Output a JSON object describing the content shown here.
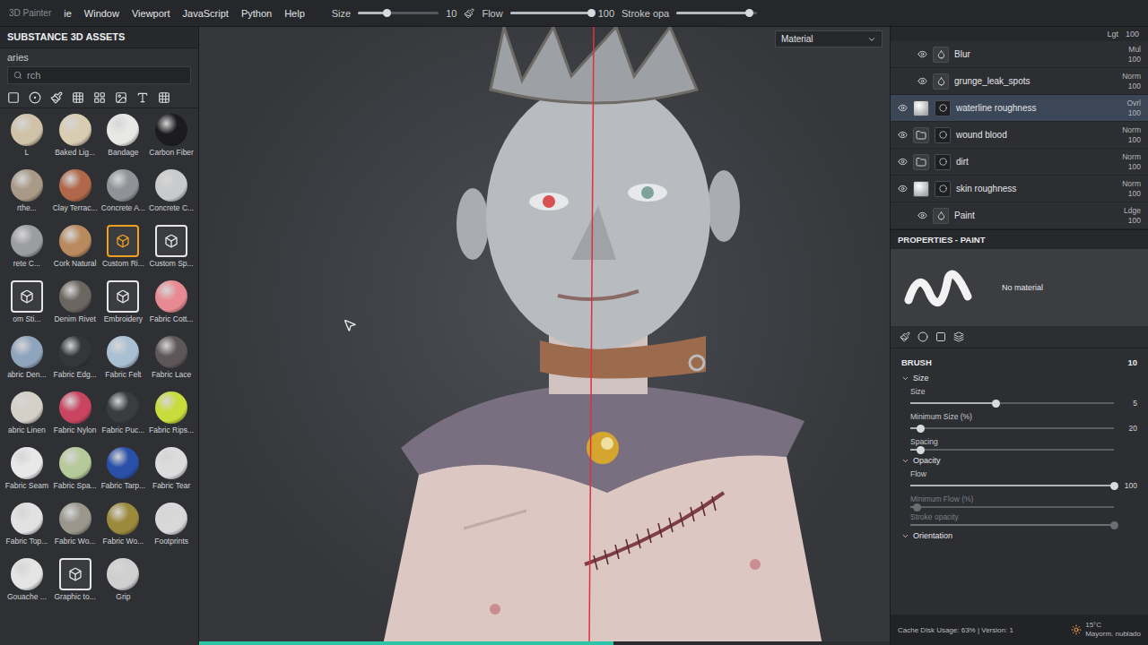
{
  "app": {
    "title": "3D Painter"
  },
  "menu": [
    {
      "label": "ie"
    },
    {
      "label": "Window"
    },
    {
      "label": "Viewport"
    },
    {
      "label": "JavaScript"
    },
    {
      "label": "Python"
    },
    {
      "label": "Help"
    }
  ],
  "toolbar": {
    "size": {
      "label": "Size",
      "value": "10",
      "level": 0.35
    },
    "flow": {
      "label": "Flow",
      "value": "100",
      "level": 1
    },
    "stroke": {
      "label": "Stroke opa",
      "level": 0.9
    }
  },
  "assets": {
    "title": "SUBSTANCE 3D ASSETS",
    "section": "aries",
    "search": "rch",
    "materials": [
      {
        "label": "L",
        "kind": "sphere",
        "color": "#cfc2a6"
      },
      {
        "label": "Baked Lig...",
        "kind": "sphere",
        "color": "#d9ccb0"
      },
      {
        "label": "Bandage",
        "kind": "sphere",
        "color": "#e8e8e6"
      },
      {
        "label": "Carbon Fiber",
        "kind": "sphere",
        "color": "#1c1c1e"
      },
      {
        "label": "rthe...",
        "kind": "sphere",
        "color": "#a89a86"
      },
      {
        "label": "Clay Terrac...",
        "kind": "sphere",
        "color": "#b0674a"
      },
      {
        "label": "Concrete A...",
        "kind": "sphere",
        "color": "#8f9296"
      },
      {
        "label": "Concrete C...",
        "kind": "sphere",
        "color": "#c9cacb"
      },
      {
        "label": "rete C...",
        "kind": "sphere",
        "color": "#9c9d9f"
      },
      {
        "label": "Cork Natural",
        "kind": "sphere",
        "color": "#b98a5e"
      },
      {
        "label": "Custom Ri...",
        "kind": "icon",
        "color": "#f0a020"
      },
      {
        "label": "Custom Sp...",
        "kind": "icon",
        "color": "#e6e6e6"
      },
      {
        "label": "om Sti...",
        "kind": "icon",
        "color": "#e6e6e6"
      },
      {
        "label": "Denim Rivet",
        "kind": "sphere",
        "color": "#6c6660"
      },
      {
        "label": "Embroidery",
        "kind": "icon",
        "color": "#e6e6e6"
      },
      {
        "label": "Fabric Cott...",
        "kind": "sphere",
        "color": "#e88a92"
      },
      {
        "label": "abric Den...",
        "kind": "sphere",
        "color": "#8fa4bd"
      },
      {
        "label": "Fabric Edg...",
        "kind": "sphere",
        "color": "#34363a"
      },
      {
        "label": "Fabric Felt",
        "kind": "sphere",
        "color": "#a9bfd2"
      },
      {
        "label": "Fabric Lace",
        "kind": "sphere",
        "color": "#5e5658"
      },
      {
        "label": "abric Linen",
        "kind": "sphere",
        "color": "#d4d0c8"
      },
      {
        "label": "Fabric Nylon",
        "kind": "sphere",
        "color": "#c9455f"
      },
      {
        "label": "Fabric Puc...",
        "kind": "sphere",
        "color": "#3a3c40"
      },
      {
        "label": "Fabric Rips...",
        "kind": "sphere",
        "color": "#c8dc3c"
      },
      {
        "label": "Fabric Seam",
        "kind": "sphere",
        "color": "#e8e8e8"
      },
      {
        "label": "Fabric Spa...",
        "kind": "sphere",
        "color": "#b6c99a"
      },
      {
        "label": "Fabric Tarp...",
        "kind": "sphere",
        "color": "#2a4fa8"
      },
      {
        "label": "Fabric Tear",
        "kind": "sphere",
        "color": "#dcdcdc"
      },
      {
        "label": "Fabric Top...",
        "kind": "sphere",
        "color": "#e2e2e2"
      },
      {
        "label": "Fabric Wo...",
        "kind": "sphere",
        "color": "#9a968c"
      },
      {
        "label": "Fabric Wo...",
        "kind": "sphere",
        "color": "#9c8a3c"
      },
      {
        "label": "Footprints",
        "kind": "sphere",
        "color": "#d8d8d8"
      },
      {
        "label": "Gouache ...",
        "kind": "sphere",
        "color": "#e4e4e4"
      },
      {
        "label": "Graphic to...",
        "kind": "icon",
        "color": "#e6e6e6"
      },
      {
        "label": "Grip",
        "kind": "sphere",
        "color": "#cfcfcf"
      }
    ]
  },
  "viewport": {
    "channel": "Material",
    "progress": 0.6
  },
  "layers_header": {
    "blend": "Lgt",
    "opacity": "100"
  },
  "layers": [
    {
      "name": "Blur",
      "blend": "Mul",
      "opacity": "100",
      "visible": true,
      "selected": false,
      "kind": "effect"
    },
    {
      "name": "grunge_leak_spots",
      "blend": "Norm",
      "opacity": "100",
      "visible": true,
      "selected": false,
      "kind": "effect"
    },
    {
      "name": "waterline roughness",
      "blend": "Ovrl",
      "opacity": "100",
      "visible": true,
      "selected": true,
      "kind": "fill"
    },
    {
      "name": "wound blood",
      "blend": "Norm",
      "opacity": "100",
      "visible": true,
      "selected": false,
      "kind": "folder"
    },
    {
      "name": "dirt",
      "blend": "Norm",
      "opacity": "100",
      "visible": true,
      "selected": false,
      "kind": "folder"
    },
    {
      "name": "skin roughness",
      "blend": "Norm",
      "opacity": "100",
      "visible": true,
      "selected": false,
      "kind": "fill"
    },
    {
      "name": "Paint",
      "blend": "Ldge",
      "opacity": "100",
      "visible": true,
      "selected": false,
      "kind": "effect"
    }
  ],
  "properties": {
    "title": "PROPERTIES - PAINT",
    "preview": "No material",
    "brush": {
      "label": "BRUSH",
      "value": "10"
    },
    "sections": [
      {
        "label": "Size",
        "expanded": true,
        "sliders": [
          {
            "label": "Size",
            "value": "5",
            "level": 0.42,
            "disabled": false
          },
          {
            "label": "Minimum Size (%)",
            "value": "20",
            "level": 0.05,
            "disabled": false
          },
          {
            "label": "Spacing",
            "level": 0.05,
            "disabled": false
          }
        ]
      },
      {
        "label": "Opacity",
        "expanded": true,
        "sliders": [
          {
            "label": "Flow",
            "value": "100",
            "level": 1,
            "disabled": false
          },
          {
            "label": "Minimum Flow (%)",
            "level": 0.03,
            "disabled": true
          },
          {
            "label": "Stroke opacity",
            "level": 1,
            "disabled": true
          }
        ]
      },
      {
        "label": "Orientation",
        "expanded": true,
        "sliders": []
      }
    ]
  },
  "status": {
    "cache": "Cache Disk Usage: 63%",
    "version": "Version: 1"
  },
  "weather": {
    "temp": "15°C",
    "desc": "Mayorm. nublado"
  }
}
